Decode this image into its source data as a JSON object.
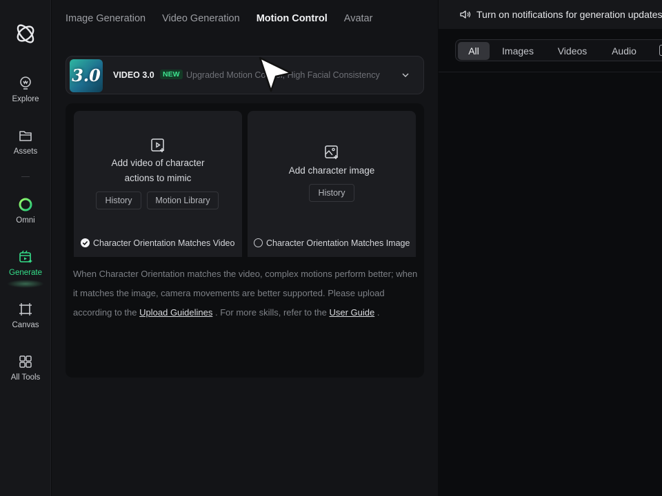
{
  "sidebar": {
    "items": [
      {
        "label": "Explore",
        "icon": "bulb-icon"
      },
      {
        "label": "Assets",
        "icon": "folder-icon"
      },
      {
        "label": "Omni",
        "icon": "omni-icon"
      },
      {
        "label": "Generate",
        "icon": "generate-icon",
        "active": true
      },
      {
        "label": "Canvas",
        "icon": "canvas-icon"
      },
      {
        "label": "All Tools",
        "icon": "grid-icon"
      }
    ]
  },
  "tabs": [
    {
      "label": "Image Generation"
    },
    {
      "label": "Video Generation"
    },
    {
      "label": "Motion Control",
      "active": true
    },
    {
      "label": "Avatar"
    }
  ],
  "model": {
    "thumb_text": "3.0",
    "name": "VIDEO 3.0",
    "badge": "NEW",
    "description": "Upgraded Motion Control, High Facial Consistency"
  },
  "cards": {
    "video": {
      "title_line1": "Add video of character",
      "title_line2": "actions to mimic",
      "btn_history": "History",
      "btn_library": "Motion Library",
      "orientation": "Character Orientation Matches Video",
      "selected": true
    },
    "image": {
      "title": "Add character image",
      "btn_history": "History",
      "orientation": "Character Orientation Matches Image",
      "selected": false
    }
  },
  "description": {
    "part1": "When Character Orientation matches the video, complex motions perform better; when it matches the image, camera movements are better supported. Please upload according to the",
    "link1": "Upload Guidelines",
    "part2": ". For more skills, refer to the",
    "link2": "User Guide",
    "part3": "."
  },
  "right": {
    "notification": "Turn on notifications for generation updates",
    "filters": [
      "All",
      "Images",
      "Videos",
      "Audio"
    ],
    "active_filter": "All"
  },
  "colors": {
    "accent": "#35e08a",
    "background": "#0b0c0e",
    "panel": "#131417"
  }
}
